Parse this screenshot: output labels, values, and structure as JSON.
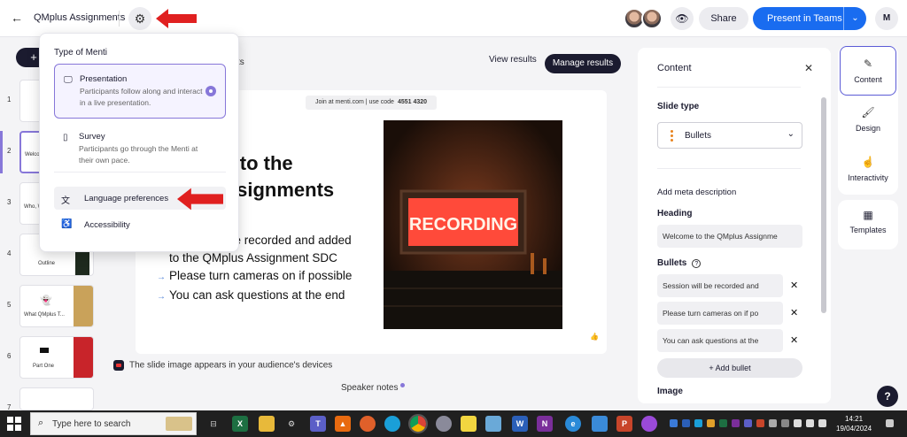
{
  "header": {
    "title": "QMplus Assignments",
    "share_label": "Share",
    "present_label": "Present in Teams",
    "menti_logo": "M"
  },
  "icons": {
    "back": "←",
    "gear": "⚙",
    "eye": "👁",
    "caret": "⌄",
    "plus": "+",
    "close": "✕",
    "chevron": "⌄"
  },
  "popup": {
    "title": "Type of Menti",
    "options": [
      {
        "name": "Presentation",
        "description": "Participants follow along and interact in a live presentation.",
        "selected": true
      },
      {
        "name": "Survey",
        "description": "Participants go through the Menti at their own pace.",
        "selected": false
      }
    ],
    "links": [
      {
        "label": "Language preferences"
      },
      {
        "label": "Accessibility"
      }
    ]
  },
  "strip": {
    "slides": [
      {
        "number": "1",
        "label": ""
      },
      {
        "number": "2",
        "label": "Welco"
      },
      {
        "number": "3",
        "label": "Who, W"
      },
      {
        "number": "4",
        "label": "Outline"
      },
      {
        "number": "5",
        "label": "What QMplus T..."
      },
      {
        "number": "6",
        "label": "Part One"
      },
      {
        "number": "7",
        "label": ""
      }
    ]
  },
  "canvas": {
    "tab_hint": "ts",
    "view_results": "View results",
    "manage_results": "Manage results",
    "join_text": "Join at menti.com | use code",
    "join_code": "4551 4320",
    "heading_line1": "ne to the",
    "heading_line2": "Assignments",
    "bullet_partial": "be recorded and added",
    "bullet_partial2": "to the QMplus Assignment SDC",
    "bullets": [
      "Please turn cameras on if possible",
      "You can ask questions at the end"
    ],
    "image_sign_text": "RECORDING",
    "audience_note": "The slide image appears in your audience's devices",
    "speaker_notes": "Speaker notes"
  },
  "panel": {
    "title": "Content",
    "slide_type_label": "Slide type",
    "slide_type_value": "Bullets",
    "meta_label": "Add meta description",
    "heading_label": "Heading",
    "heading_value": "Welcome to the QMplus Assignme",
    "bullets_label": "Bullets",
    "bullet_values": [
      "Session will be recorded and",
      "Please turn cameras on if po",
      "You can ask questions at the"
    ],
    "add_bullet_label": "+ Add bullet",
    "image_label": "Image"
  },
  "side_tabs": [
    {
      "label": "Content",
      "icon": "✎"
    },
    {
      "label": "Design",
      "icon": "🖌"
    },
    {
      "label": "Interactivity",
      "icon": "☝"
    },
    {
      "label": "Templates",
      "icon": "▦"
    }
  ],
  "help_label": "?",
  "taskbar": {
    "search_placeholder": "Type here to search",
    "time": "14:21",
    "date": "19/04/2024"
  },
  "colors": {
    "accent": "#8777d9",
    "primary": "#196cf0",
    "arrow": "#e02020"
  }
}
